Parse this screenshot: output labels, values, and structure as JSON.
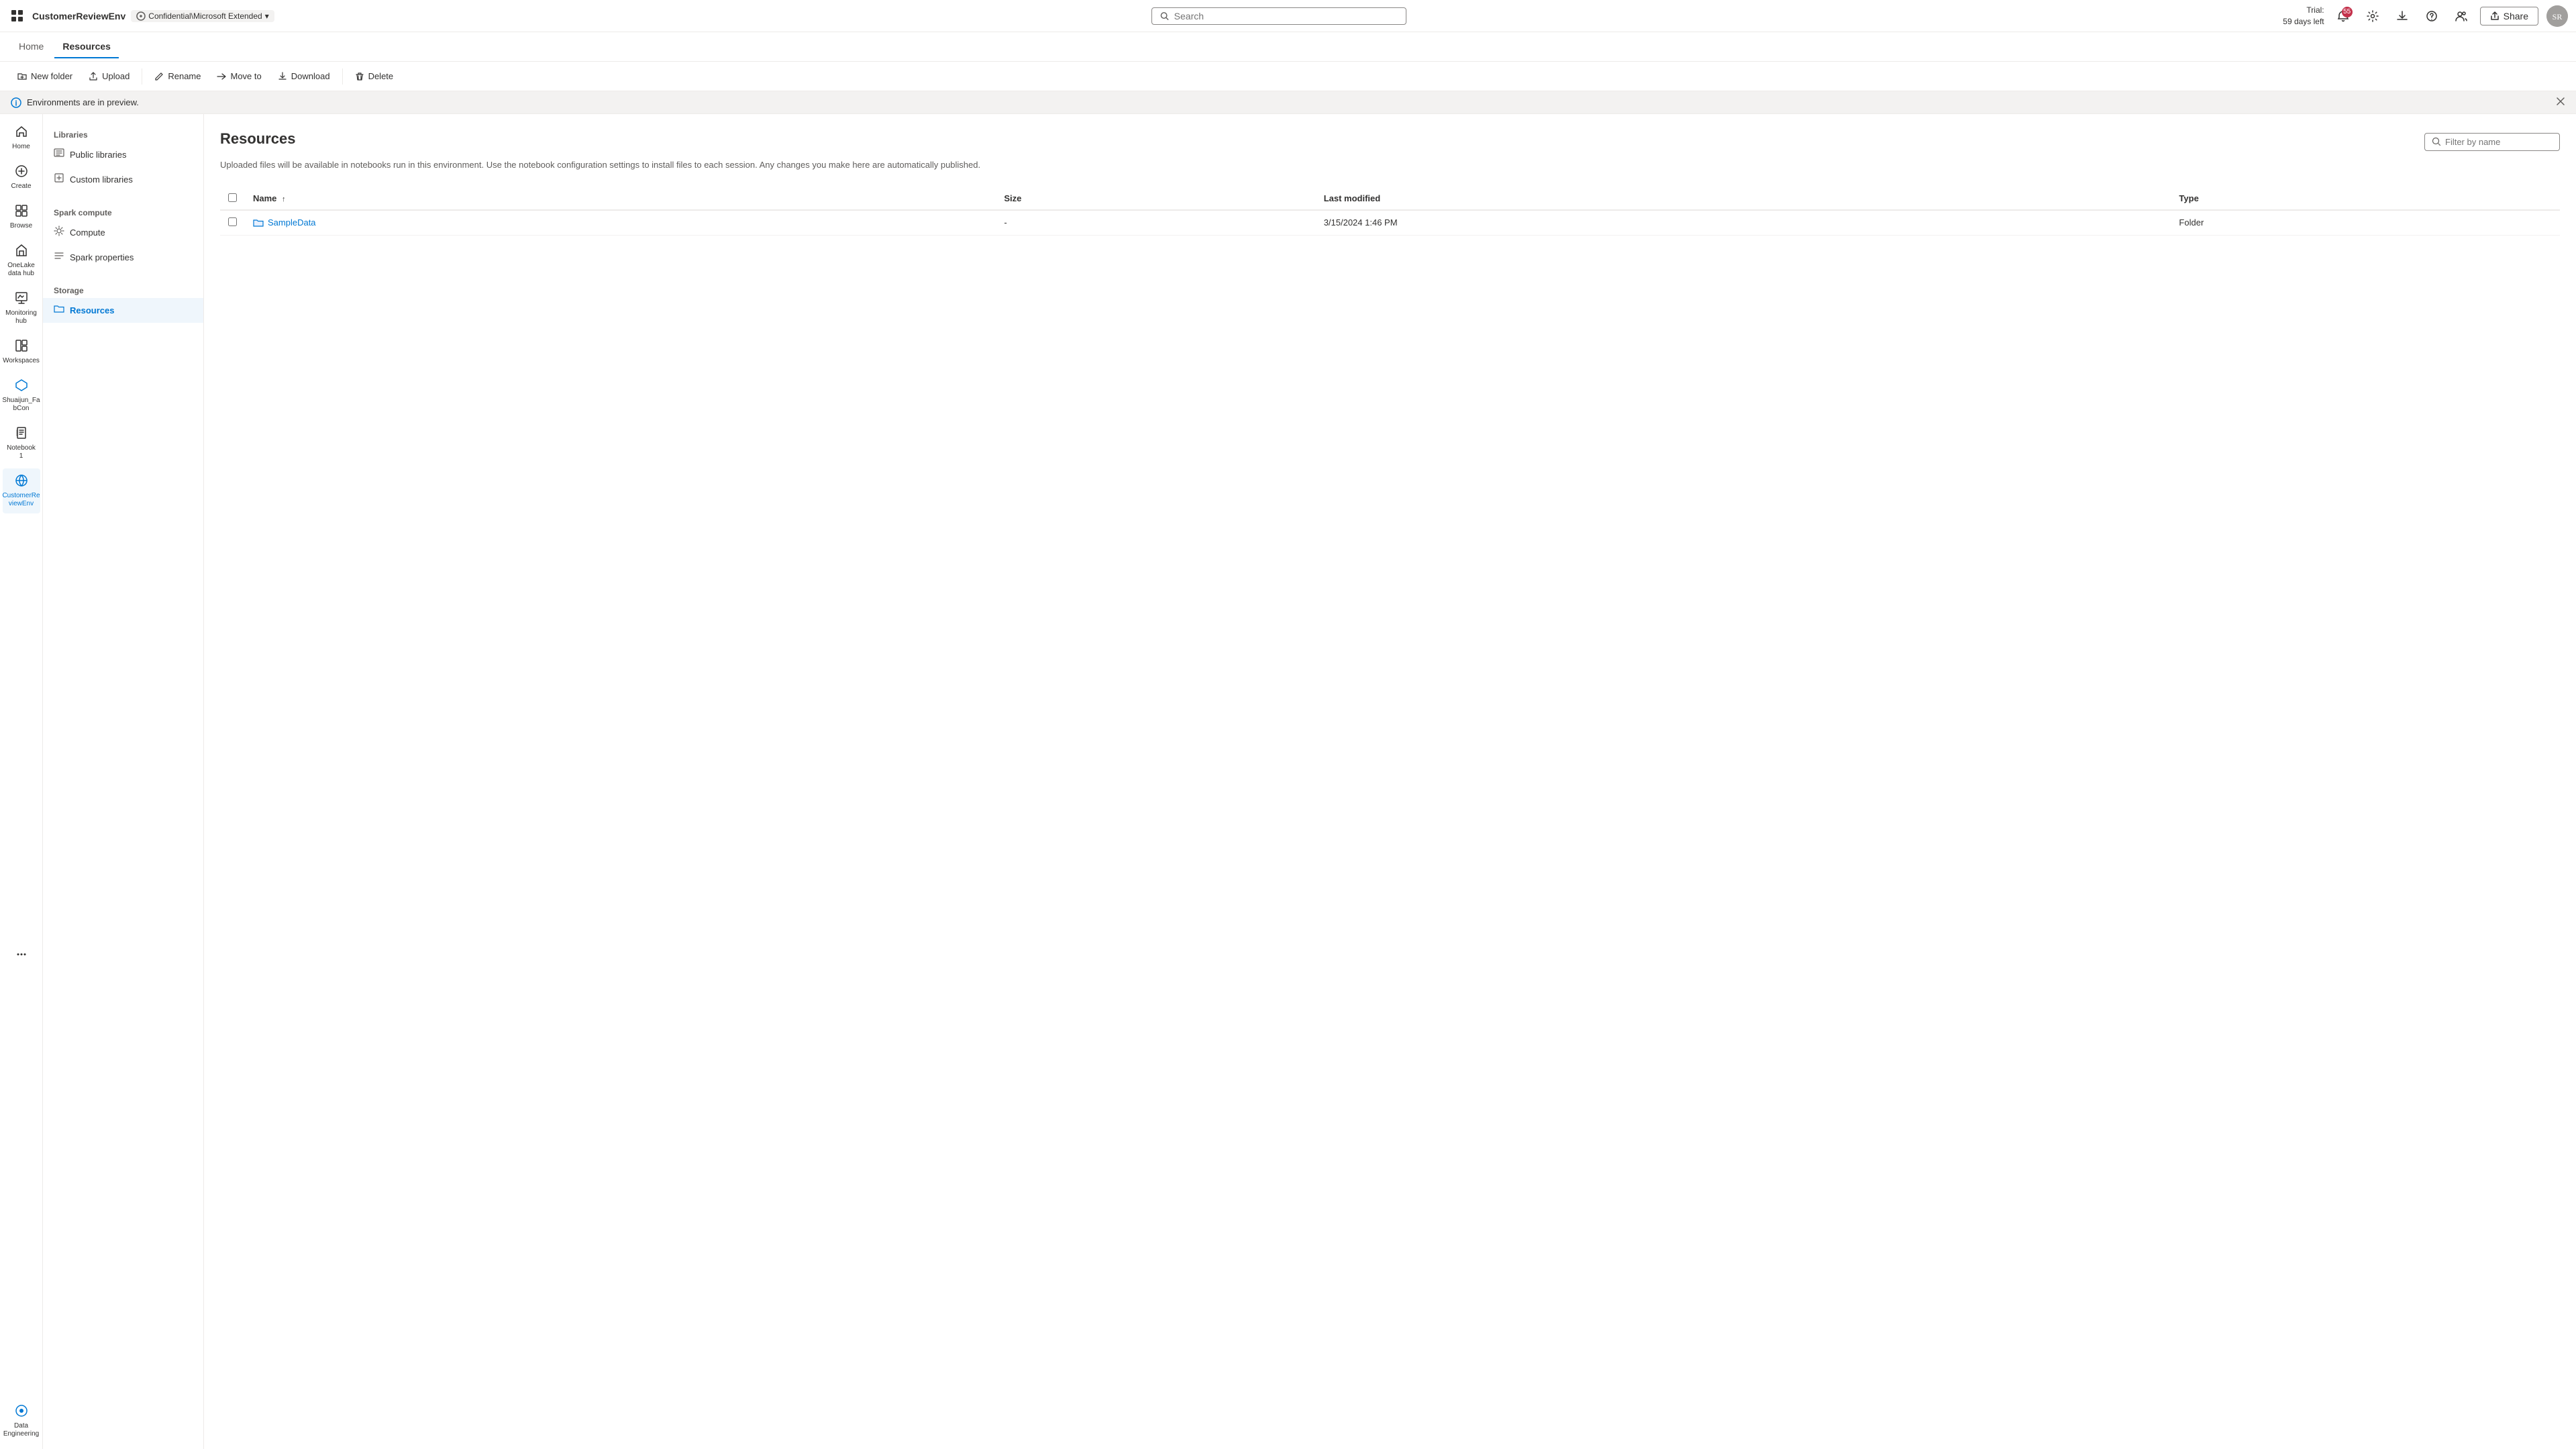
{
  "topbar": {
    "app_grid_icon": "⊞",
    "app_name": "CustomerReviewEnv",
    "env_label": "Confidential\\Microsoft Extended",
    "search_placeholder": "Search",
    "trial_line1": "Trial:",
    "trial_line2": "59 days left",
    "notification_count": "55",
    "share_label": "Share",
    "avatar_initials": "SR"
  },
  "nav_tabs": {
    "home_label": "Home",
    "resources_label": "Resources"
  },
  "toolbar": {
    "new_folder_label": "New folder",
    "upload_label": "Upload",
    "rename_label": "Rename",
    "move_to_label": "Move to",
    "download_label": "Download",
    "delete_label": "Delete"
  },
  "preview_banner": {
    "message": "Environments are in preview."
  },
  "sidebar_nav": {
    "items": [
      {
        "id": "home",
        "label": "Home",
        "icon": "⌂"
      },
      {
        "id": "create",
        "label": "Create",
        "icon": "+"
      },
      {
        "id": "browse",
        "label": "Browse",
        "icon": "⊞"
      },
      {
        "id": "onelake",
        "label": "OneLake data hub",
        "icon": "◈"
      },
      {
        "id": "monitoring",
        "label": "Monitoring hub",
        "icon": "📊"
      },
      {
        "id": "workspaces",
        "label": "Workspaces",
        "icon": "⬛"
      },
      {
        "id": "shaijun",
        "label": "Shuaijun_Fa bCon",
        "icon": "🔷"
      },
      {
        "id": "notebook1",
        "label": "Notebook 1",
        "icon": "📓"
      },
      {
        "id": "customerenv",
        "label": "CustomerRe viewEnv",
        "icon": "🌍"
      },
      {
        "id": "more",
        "label": "...",
        "icon": "···"
      },
      {
        "id": "dataeng",
        "label": "Data Engineering",
        "icon": "⚙"
      }
    ]
  },
  "left_panel": {
    "libraries_title": "Libraries",
    "libraries_items": [
      {
        "id": "public",
        "label": "Public libraries",
        "icon": "📚"
      },
      {
        "id": "custom",
        "label": "Custom libraries",
        "icon": "📦"
      }
    ],
    "spark_title": "Spark compute",
    "spark_items": [
      {
        "id": "compute",
        "label": "Compute",
        "icon": "⚙"
      },
      {
        "id": "spark_props",
        "label": "Spark properties",
        "icon": "🔧"
      }
    ],
    "storage_title": "Storage",
    "storage_items": [
      {
        "id": "resources",
        "label": "Resources",
        "icon": "📁"
      }
    ]
  },
  "content": {
    "title": "Resources",
    "description": "Uploaded files will be available in notebooks run in this environment. Use the notebook configuration settings to install files to each session. Any changes you make here are automatically published.",
    "filter_placeholder": "Filter by name",
    "table": {
      "columns": [
        "Name",
        "Size",
        "Last modified",
        "Type"
      ],
      "rows": [
        {
          "name": "SampleData",
          "size": "-",
          "last_modified": "3/15/2024 1:46 PM",
          "type": "Folder"
        }
      ]
    }
  }
}
